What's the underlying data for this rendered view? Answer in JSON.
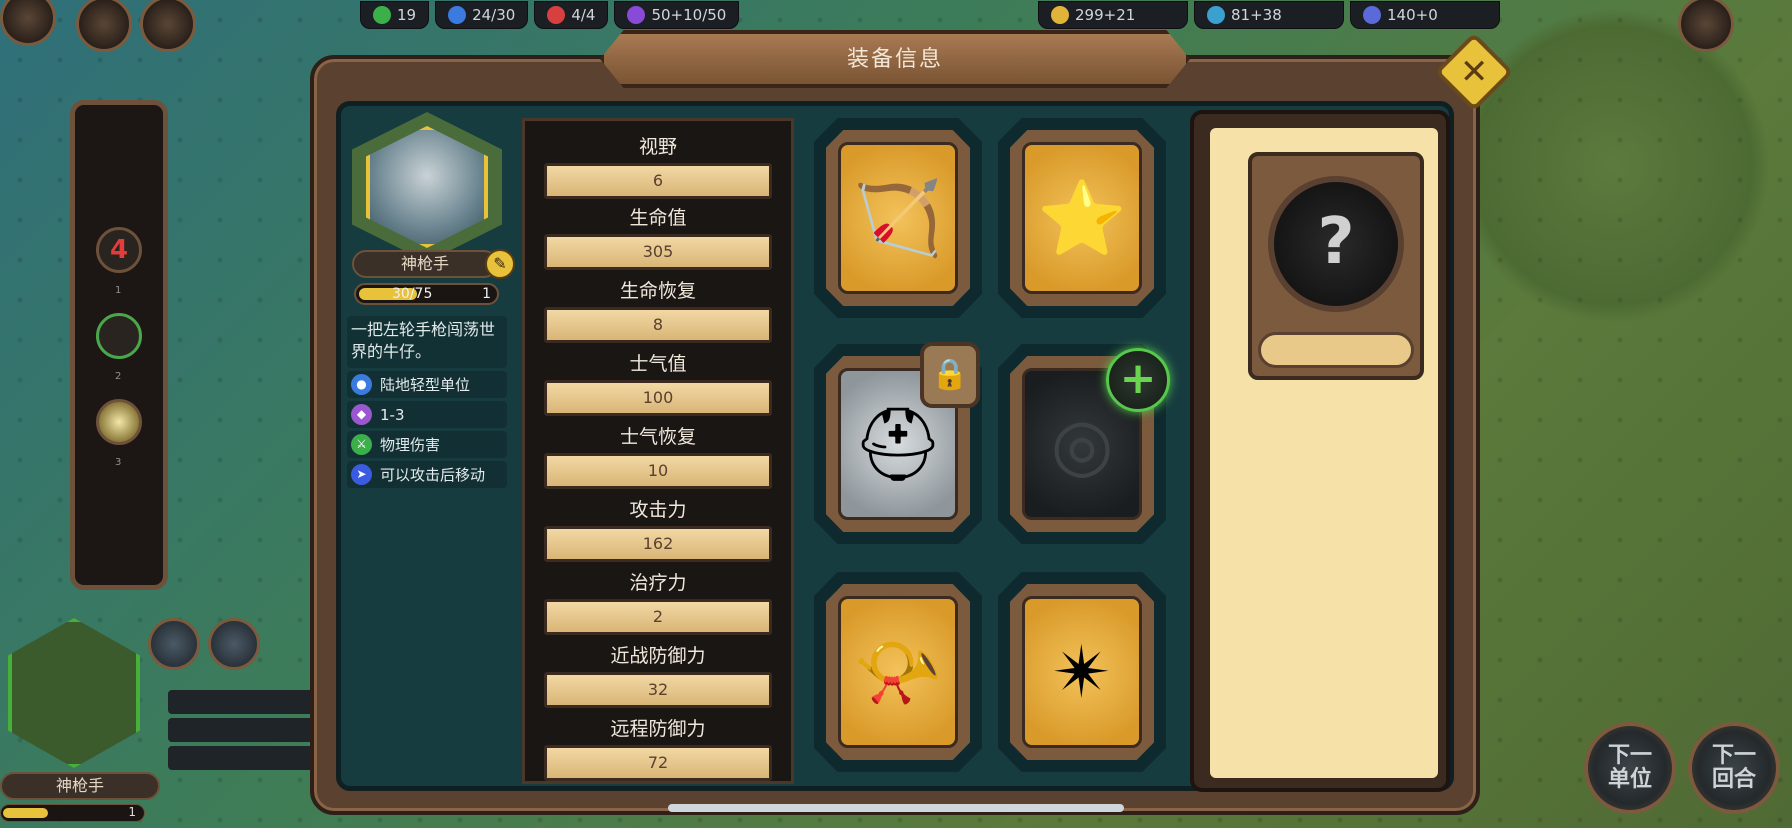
{
  "topbar": {
    "resources": [
      {
        "icon": "population-icon",
        "color": "#3bb04a",
        "value": "19"
      },
      {
        "icon": "unit-capacity-icon",
        "color": "#3b7be0",
        "value": "24/30"
      },
      {
        "icon": "hero-icon",
        "color": "#d84040",
        "value": "4/4"
      },
      {
        "icon": "magic-icon",
        "color": "#8a4ad8",
        "value": "50+10/50"
      }
    ],
    "resources_right": [
      {
        "icon": "gold-icon",
        "color": "#e2b33a",
        "value": "299+21"
      },
      {
        "icon": "book-icon",
        "color": "#3aa0d0",
        "value": "81+38"
      },
      {
        "icon": "science-icon",
        "color": "#5a6ad8",
        "value": "140+0"
      }
    ]
  },
  "modal": {
    "title": "装备信息",
    "close_icon": "close-icon"
  },
  "unit": {
    "name": "神枪手",
    "exp": "30/75",
    "level": "1",
    "description": "一把左轮手枪闯荡世界的牛仔。",
    "traits": [
      {
        "icon": "land-unit-icon",
        "color": "#3b7be0",
        "label": "陆地轻型单位"
      },
      {
        "icon": "range-icon",
        "color": "#9a58d0",
        "label": "1-3"
      },
      {
        "icon": "physical-damage-icon",
        "color": "#3bb04a",
        "label": "物理伤害"
      },
      {
        "icon": "move-after-attack-icon",
        "color": "#3b5be0",
        "label": "可以攻击后移动"
      }
    ]
  },
  "stats": [
    {
      "label": "视野",
      "value": "6"
    },
    {
      "label": "生命值",
      "value": "305"
    },
    {
      "label": "生命恢复",
      "value": "8"
    },
    {
      "label": "士气值",
      "value": "100"
    },
    {
      "label": "士气恢复",
      "value": "10"
    },
    {
      "label": "攻击力",
      "value": "162"
    },
    {
      "label": "治疗力",
      "value": "2"
    },
    {
      "label": "近战防御力",
      "value": "32"
    },
    {
      "label": "远程防御力",
      "value": "72"
    }
  ],
  "equipment": [
    {
      "name": "bow-icon",
      "glyph": "🏹",
      "style": "gold"
    },
    {
      "name": "star-staff-icon",
      "glyph": "⭐",
      "style": "gold"
    },
    {
      "name": "helmet-icon",
      "glyph": "⛑",
      "style": "silver"
    },
    {
      "name": "empty-slot-icon",
      "glyph": "◎",
      "style": "dark"
    },
    {
      "name": "horn-icon",
      "glyph": "📯",
      "style": "gold"
    },
    {
      "name": "crystal-icon",
      "glyph": "✴",
      "style": "gold"
    }
  ],
  "detail": {
    "unknown_glyph": "?"
  },
  "left_panel": {
    "slots": [
      {
        "value": "4",
        "num": "1"
      },
      {
        "value": "",
        "num": "2"
      },
      {
        "value": "",
        "num": "3"
      }
    ]
  },
  "bottom": {
    "unit_name": "神枪手",
    "level": "1",
    "next_unit": "下一单位",
    "next_turn": "下一回合"
  }
}
